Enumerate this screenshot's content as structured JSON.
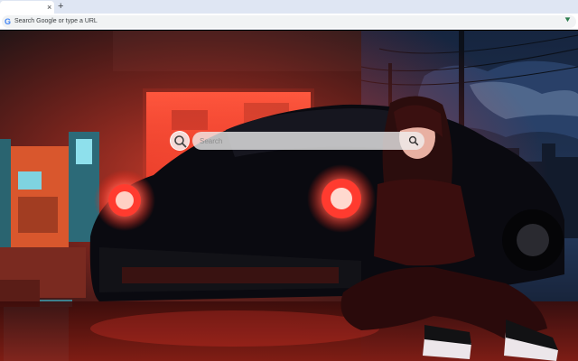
{
  "browser": {
    "tab": {
      "close_glyph": "×"
    },
    "new_tab_glyph": "+",
    "omnibox": {
      "placeholder": "Search Google or type a URL",
      "icon": "google-g-icon"
    },
    "extension_icon": "extension-icon"
  },
  "page": {
    "background": "anime-girl-porsche-night-wallpaper",
    "search": {
      "placeholder": "Search",
      "left_icon": "magnifier-icon",
      "button_icon": "search-icon"
    }
  },
  "colors": {
    "tabstrip": "#dfe6f3",
    "omnibox": "#f1f3f4",
    "neon_red": "#ff3b2f",
    "night_sky": "#1d3150"
  }
}
